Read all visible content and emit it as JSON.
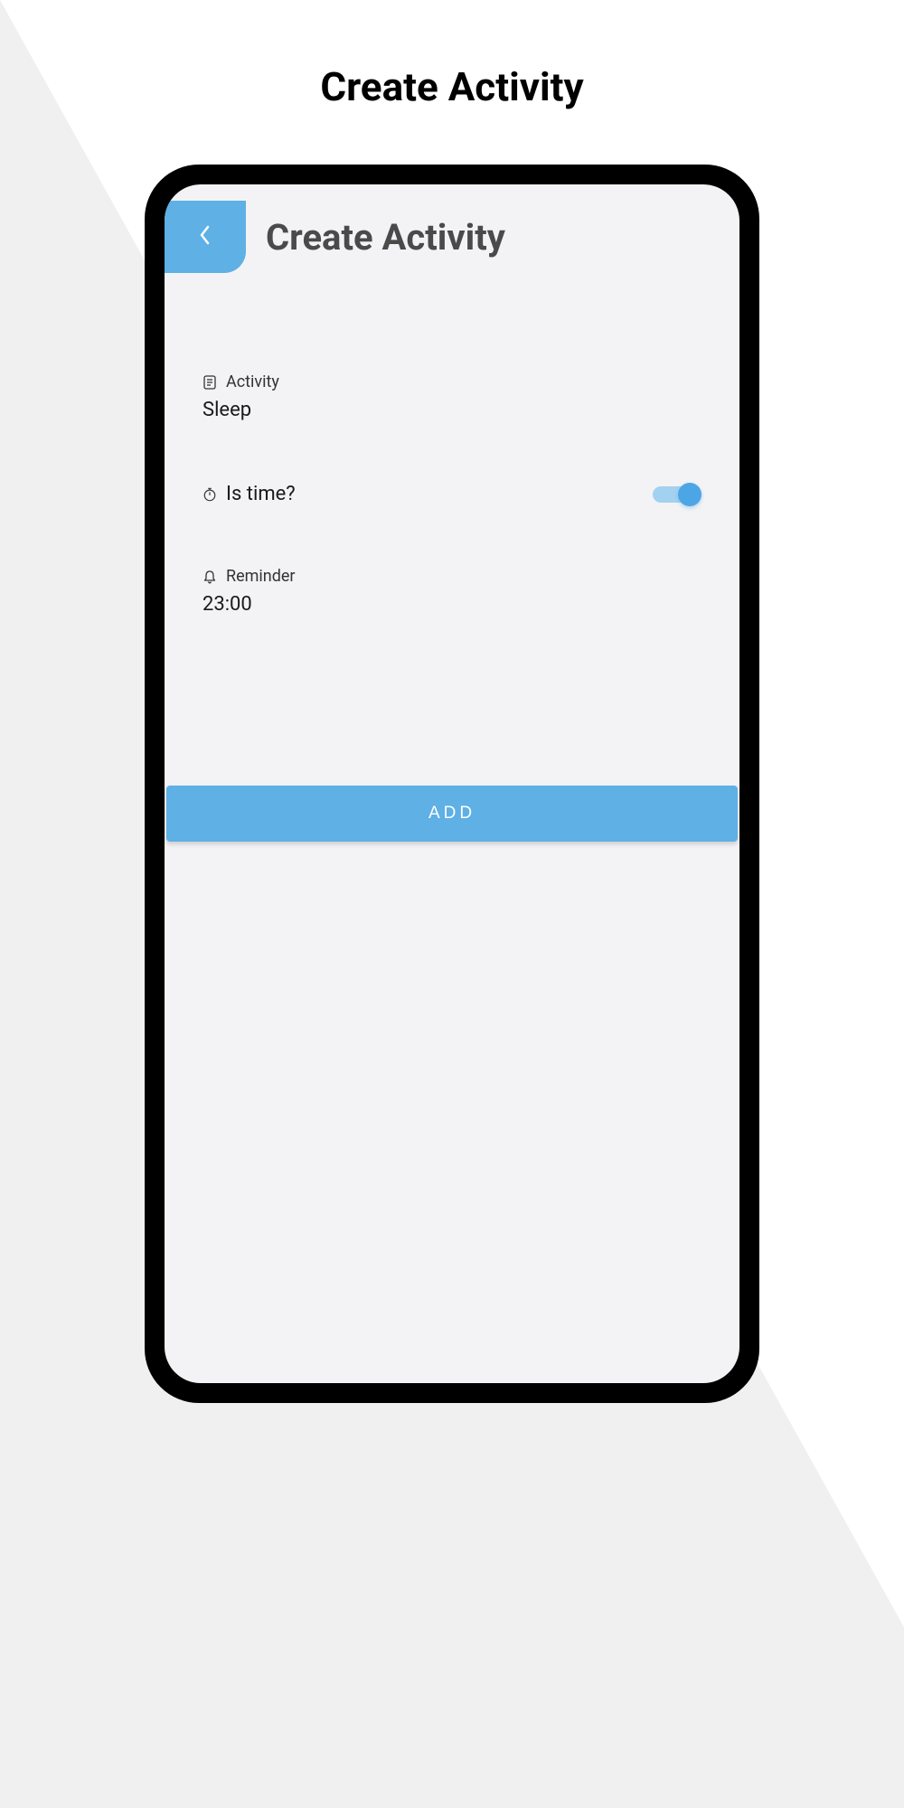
{
  "outer": {
    "title": "Create Activity"
  },
  "header": {
    "title": "Create Activity"
  },
  "form": {
    "activity": {
      "label": "Activity",
      "value": "Sleep"
    },
    "is_time": {
      "label": "Is time?",
      "enabled": true
    },
    "reminder": {
      "label": "Reminder",
      "value": "23:00"
    }
  },
  "actions": {
    "add_label": "ADD"
  }
}
